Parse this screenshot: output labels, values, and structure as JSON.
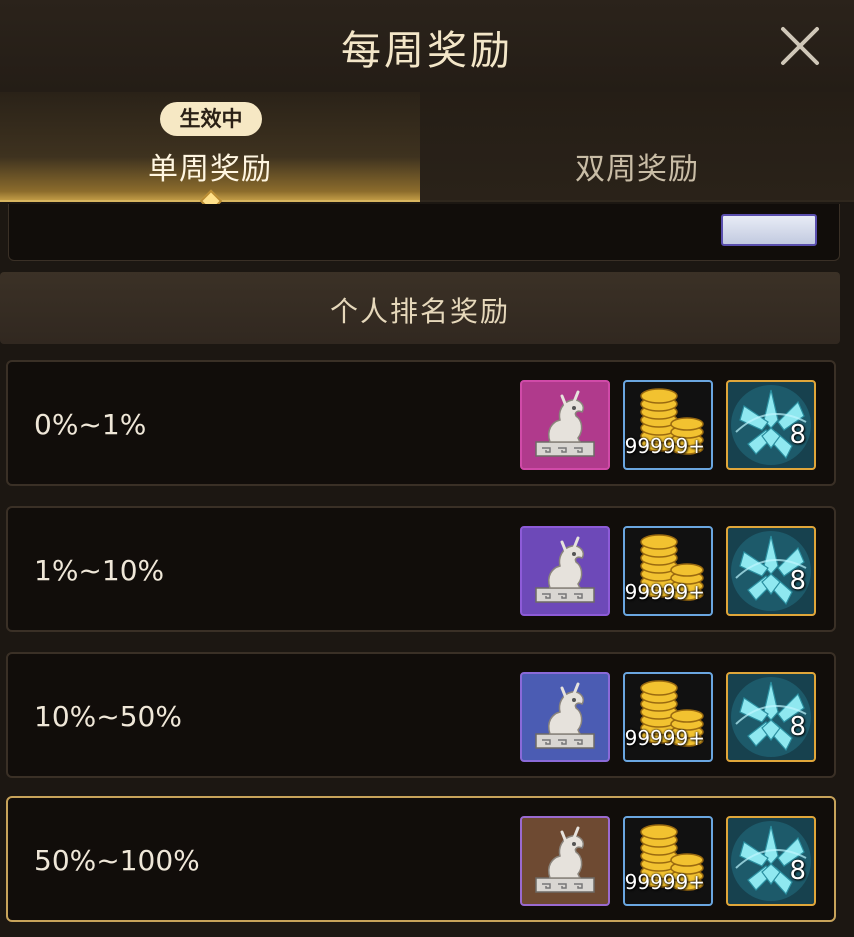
{
  "header": {
    "title": "每周奖励"
  },
  "tabs": {
    "active_badge": "生效中",
    "items": [
      {
        "label": "单周奖励",
        "active": true
      },
      {
        "label": "双周奖励",
        "active": false
      }
    ]
  },
  "section": {
    "title": "个人排名奖励"
  },
  "rows": [
    {
      "range": "0%~1%",
      "statue_quality": "pink",
      "coin_qty": "99999+",
      "crystal_qty": "8"
    },
    {
      "range": "1%~10%",
      "statue_quality": "purple",
      "coin_qty": "99999+",
      "crystal_qty": "8"
    },
    {
      "range": "10%~50%",
      "statue_quality": "blue",
      "coin_qty": "99999+",
      "crystal_qty": "8"
    },
    {
      "range": "50%~100%",
      "statue_quality": "brown",
      "coin_qty": "99999+",
      "crystal_qty": "8"
    }
  ],
  "colors": {
    "accent_gold": "#d8b560",
    "panel_bg": "#110d0a",
    "page_bg": "#1c1712"
  }
}
